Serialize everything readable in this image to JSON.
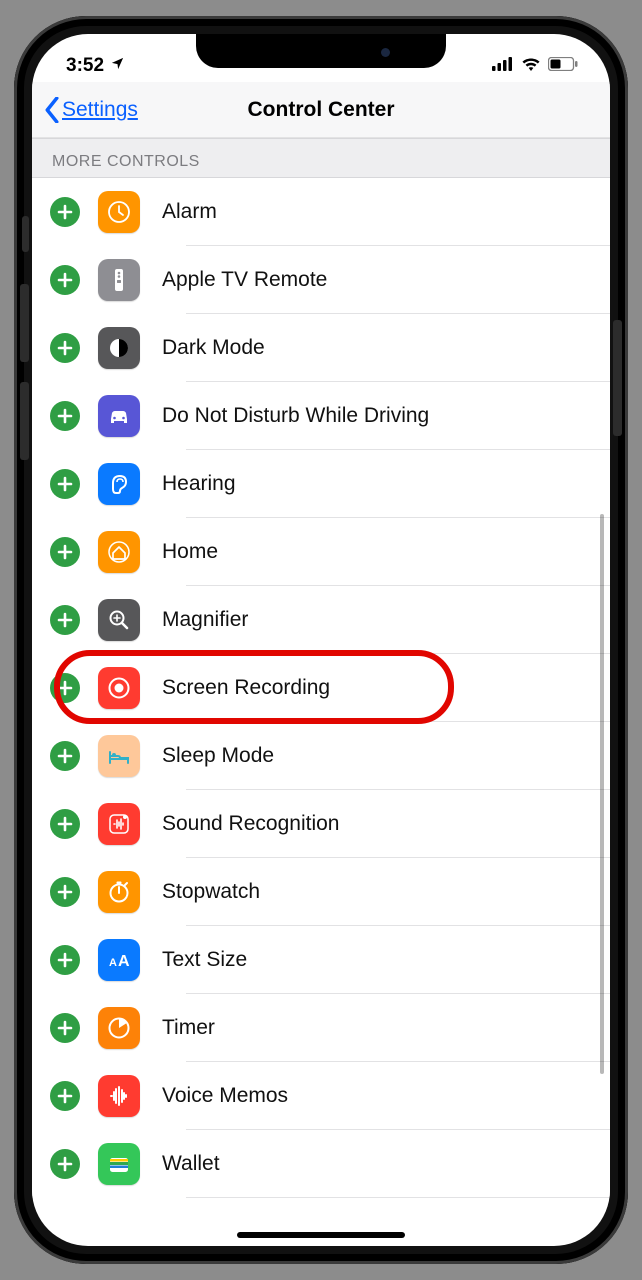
{
  "status": {
    "time": "3:52",
    "location_icon": "location-arrow"
  },
  "nav": {
    "back_label": "Settings",
    "title": "Control Center"
  },
  "section": {
    "header": "MORE CONTROLS"
  },
  "rows": [
    {
      "id": "alarm",
      "label": "Alarm",
      "icon": "clock-icon",
      "bg": "bg-orange"
    },
    {
      "id": "apple-tv-remote",
      "label": "Apple TV Remote",
      "icon": "remote-icon",
      "bg": "bg-gray"
    },
    {
      "id": "dark-mode",
      "label": "Dark Mode",
      "icon": "darkmode-icon",
      "bg": "bg-darkgray"
    },
    {
      "id": "dnd-driving",
      "label": "Do Not Disturb While Driving",
      "icon": "car-icon",
      "bg": "bg-purple"
    },
    {
      "id": "hearing",
      "label": "Hearing",
      "icon": "ear-icon",
      "bg": "bg-blue"
    },
    {
      "id": "home",
      "label": "Home",
      "icon": "home-icon",
      "bg": "bg-orange"
    },
    {
      "id": "magnifier",
      "label": "Magnifier",
      "icon": "magnifier-icon",
      "bg": "bg-darkgray"
    },
    {
      "id": "screen-recording",
      "label": "Screen Recording",
      "icon": "record-icon",
      "bg": "bg-red",
      "highlighted": true
    },
    {
      "id": "sleep-mode",
      "label": "Sleep Mode",
      "icon": "bed-icon",
      "bg": "bg-skin"
    },
    {
      "id": "sound-recognition",
      "label": "Sound Recognition",
      "icon": "soundwave-icon",
      "bg": "bg-red"
    },
    {
      "id": "stopwatch",
      "label": "Stopwatch",
      "icon": "stopwatch-icon",
      "bg": "bg-orange"
    },
    {
      "id": "text-size",
      "label": "Text Size",
      "icon": "textsize-icon",
      "bg": "bg-blue"
    },
    {
      "id": "timer",
      "label": "Timer",
      "icon": "timer-icon",
      "bg": "bg-orange2"
    },
    {
      "id": "voice-memos",
      "label": "Voice Memos",
      "icon": "voicewave-icon",
      "bg": "bg-red"
    },
    {
      "id": "wallet",
      "label": "Wallet",
      "icon": "wallet-icon",
      "bg": "bg-teal"
    }
  ],
  "colors": {
    "accent": "#0a60ff",
    "add": "#2f9e44",
    "highlight": "#e10600"
  }
}
